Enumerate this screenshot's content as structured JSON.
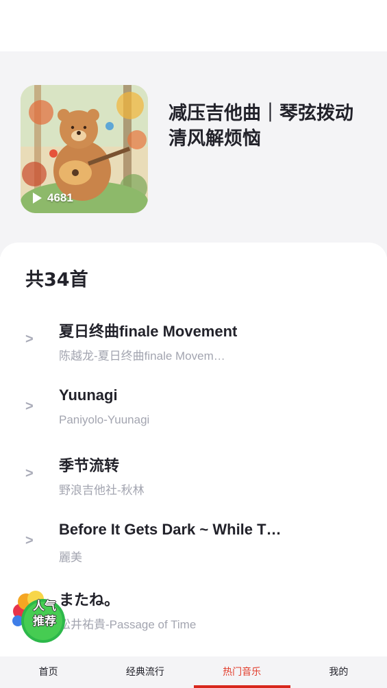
{
  "playlist": {
    "title": "减压吉他曲｜琴弦拨动清风解烦恼",
    "play_count": "4681",
    "cover_icon": "bear-playing-guitar-illustration"
  },
  "song_count_label": "共34首",
  "songs": [
    {
      "title": "夏日终曲finale Movement",
      "subtitle": "陈越龙-夏日终曲finale Movem…"
    },
    {
      "title": "Yuunagi",
      "subtitle": "Paniyolo-Yuunagi"
    },
    {
      "title": "季节流转",
      "subtitle": "野浪吉他社-秋林"
    },
    {
      "title": "Before It Gets Dark ~ While T…",
      "subtitle": "麗美"
    },
    {
      "title": "またね。",
      "subtitle": "松井祐貴-Passage of Time"
    }
  ],
  "badge": {
    "line1": "人气",
    "line2": "推荐"
  },
  "tabs": [
    {
      "label": "首页"
    },
    {
      "label": "经典流行"
    },
    {
      "label": "热门音乐",
      "active": true
    },
    {
      "label": "我的"
    }
  ],
  "colors": {
    "accent": "#d8271c",
    "text": "#22222a",
    "subtext": "#a3a5b0",
    "header_bg": "#f4f4f6"
  }
}
